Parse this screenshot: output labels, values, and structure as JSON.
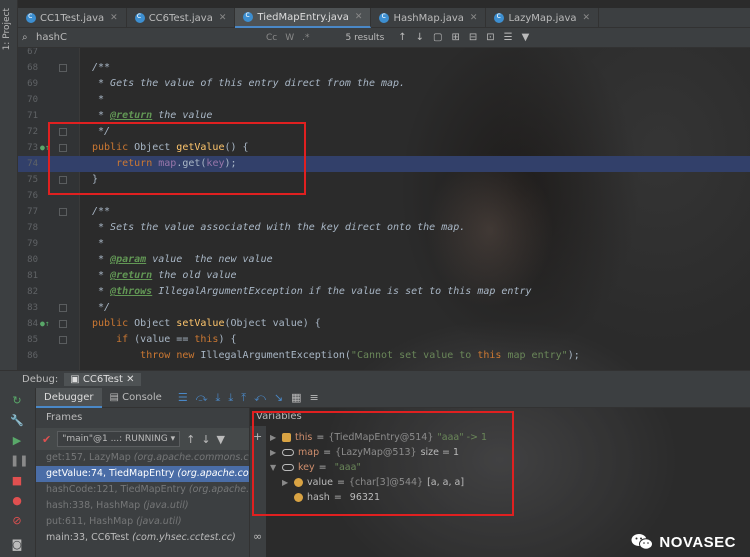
{
  "tabs": [
    {
      "label": "CC1Test.java",
      "active": false
    },
    {
      "label": "CC6Test.java",
      "active": false
    },
    {
      "label": "TiedMapEntry.java",
      "active": true
    },
    {
      "label": "HashMap.java",
      "active": false
    },
    {
      "label": "LazyMap.java",
      "active": false
    }
  ],
  "project_label": "1: Project",
  "search": {
    "value": "hashC",
    "results": "5 results",
    "options": [
      "Cc",
      "W",
      ".*"
    ]
  },
  "editor": {
    "lines": [
      {
        "n": "67",
        "code": ""
      },
      {
        "n": "68",
        "code": "/**"
      },
      {
        "n": "69",
        "code": " * Gets the value of this entry direct from the map."
      },
      {
        "n": "70",
        "code": " *"
      },
      {
        "n": "71",
        "code": " * @return the value"
      },
      {
        "n": "72",
        "code": " */"
      },
      {
        "n": "73",
        "code": "public Object getValue() {"
      },
      {
        "n": "74",
        "code": "    return map.get(key);"
      },
      {
        "n": "75",
        "code": "}"
      },
      {
        "n": "76",
        "code": ""
      },
      {
        "n": "77",
        "code": "/**"
      },
      {
        "n": "78",
        "code": " * Sets the value associated with the key direct onto the map."
      },
      {
        "n": "79",
        "code": " *"
      },
      {
        "n": "80",
        "code": " * @param value  the new value"
      },
      {
        "n": "81",
        "code": " * @return the old value"
      },
      {
        "n": "82",
        "code": " * @throws IllegalArgumentException if the value is set to this map entry"
      },
      {
        "n": "83",
        "code": " */"
      },
      {
        "n": "84",
        "code": "public Object setValue(Object value) {"
      },
      {
        "n": "85",
        "code": "    if (value == this) {"
      },
      {
        "n": "86",
        "code": "        throw new IllegalArgumentException(\"Cannot set value to this map entry\");"
      }
    ]
  },
  "debug": {
    "label": "Debug:",
    "session": "CC6Test",
    "tabs": [
      "Debugger",
      "Console"
    ]
  },
  "frames": {
    "title": "Frames",
    "thread": "\"main\"@1 ...: RUNNING",
    "items": [
      {
        "method": "get:157, LazyMap",
        "pkg": "(org.apache.commons.co",
        "state": "dim"
      },
      {
        "method": "getValue:74, TiedMapEntry",
        "pkg": "(org.apache.com",
        "state": "selected"
      },
      {
        "method": "hashCode:121, TiedMapEntry",
        "pkg": "(org.apache.co",
        "state": "dim"
      },
      {
        "method": "hash:338, HashMap",
        "pkg": "(java.util)",
        "state": "dim"
      },
      {
        "method": "put:611, HashMap",
        "pkg": "(java.util)",
        "state": "dim"
      },
      {
        "method": "main:33, CC6Test",
        "pkg": "(com.yhsec.cctest.cc)",
        "state": "normal"
      }
    ]
  },
  "variables": {
    "title": "Variables",
    "items": [
      {
        "name": "this",
        "eq": " = ",
        "type": "{TiedMapEntry@514}",
        "value": " \"aaa\" -> 1"
      },
      {
        "name": "map",
        "eq": " = ",
        "type": "{LazyMap@513}",
        "value": "  size = 1"
      },
      {
        "name": "key",
        "eq": " = ",
        "type": "",
        "value": "\"aaa\""
      },
      {
        "name": "value",
        "eq": " = ",
        "type": "{char[3]@544}",
        "value": " [a, a, a]"
      },
      {
        "name": "hash",
        "eq": " = ",
        "type": "",
        "value": "96321"
      }
    ]
  },
  "watermark": "NOVASEC"
}
